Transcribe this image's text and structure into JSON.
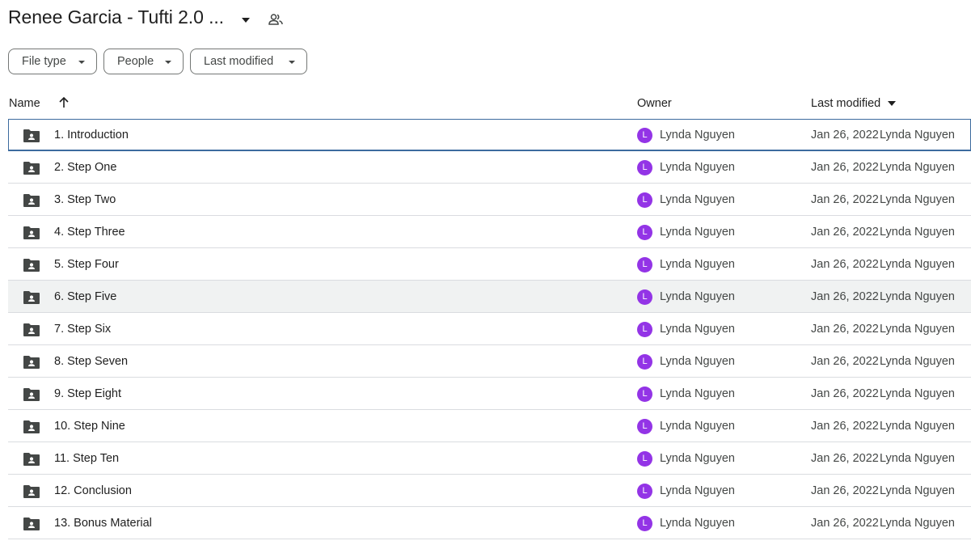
{
  "header": {
    "title": "Renee Garcia - Tufti 2.0 ...",
    "title_caret_icon": "arrow-drop-down-icon",
    "shared_icon": "people-outline-icon"
  },
  "filters": [
    {
      "label": "File type"
    },
    {
      "label": "People"
    },
    {
      "label": "Last modified"
    }
  ],
  "columns": {
    "name": "Name",
    "owner": "Owner",
    "last_modified": "Last modified",
    "sort_icon": "arrow-upward-icon",
    "sort_menu_icon": "arrow-drop-down-icon"
  },
  "colors": {
    "avatar": "#9334e6",
    "selected_border": "#3c6b9e",
    "hover_bg": "#f0f2f2"
  },
  "rows": [
    {
      "name": "1. Introduction",
      "owner_initial": "L",
      "owner": "Lynda Nguyen",
      "modified": "Jan 26, 2022",
      "modified_by": "Lynda Nguyen"
    },
    {
      "name": "2. Step One",
      "owner_initial": "L",
      "owner": "Lynda Nguyen",
      "modified": "Jan 26, 2022",
      "modified_by": "Lynda Nguyen"
    },
    {
      "name": "3. Step Two",
      "owner_initial": "L",
      "owner": "Lynda Nguyen",
      "modified": "Jan 26, 2022",
      "modified_by": "Lynda Nguyen"
    },
    {
      "name": "4. Step Three",
      "owner_initial": "L",
      "owner": "Lynda Nguyen",
      "modified": "Jan 26, 2022",
      "modified_by": "Lynda Nguyen"
    },
    {
      "name": "5. Step Four",
      "owner_initial": "L",
      "owner": "Lynda Nguyen",
      "modified": "Jan 26, 2022",
      "modified_by": "Lynda Nguyen"
    },
    {
      "name": "6. Step Five",
      "owner_initial": "L",
      "owner": "Lynda Nguyen",
      "modified": "Jan 26, 2022",
      "modified_by": "Lynda Nguyen"
    },
    {
      "name": "7. Step Six",
      "owner_initial": "L",
      "owner": "Lynda Nguyen",
      "modified": "Jan 26, 2022",
      "modified_by": "Lynda Nguyen"
    },
    {
      "name": "8. Step Seven",
      "owner_initial": "L",
      "owner": "Lynda Nguyen",
      "modified": "Jan 26, 2022",
      "modified_by": "Lynda Nguyen"
    },
    {
      "name": "9. Step Eight",
      "owner_initial": "L",
      "owner": "Lynda Nguyen",
      "modified": "Jan 26, 2022",
      "modified_by": "Lynda Nguyen"
    },
    {
      "name": "10. Step Nine",
      "owner_initial": "L",
      "owner": "Lynda Nguyen",
      "modified": "Jan 26, 2022",
      "modified_by": "Lynda Nguyen"
    },
    {
      "name": "11. Step Ten",
      "owner_initial": "L",
      "owner": "Lynda Nguyen",
      "modified": "Jan 26, 2022",
      "modified_by": "Lynda Nguyen"
    },
    {
      "name": "12. Conclusion",
      "owner_initial": "L",
      "owner": "Lynda Nguyen",
      "modified": "Jan 26, 2022",
      "modified_by": "Lynda Nguyen"
    },
    {
      "name": "13. Bonus Material",
      "owner_initial": "L",
      "owner": "Lynda Nguyen",
      "modified": "Jan 26, 2022",
      "modified_by": "Lynda Nguyen"
    }
  ]
}
